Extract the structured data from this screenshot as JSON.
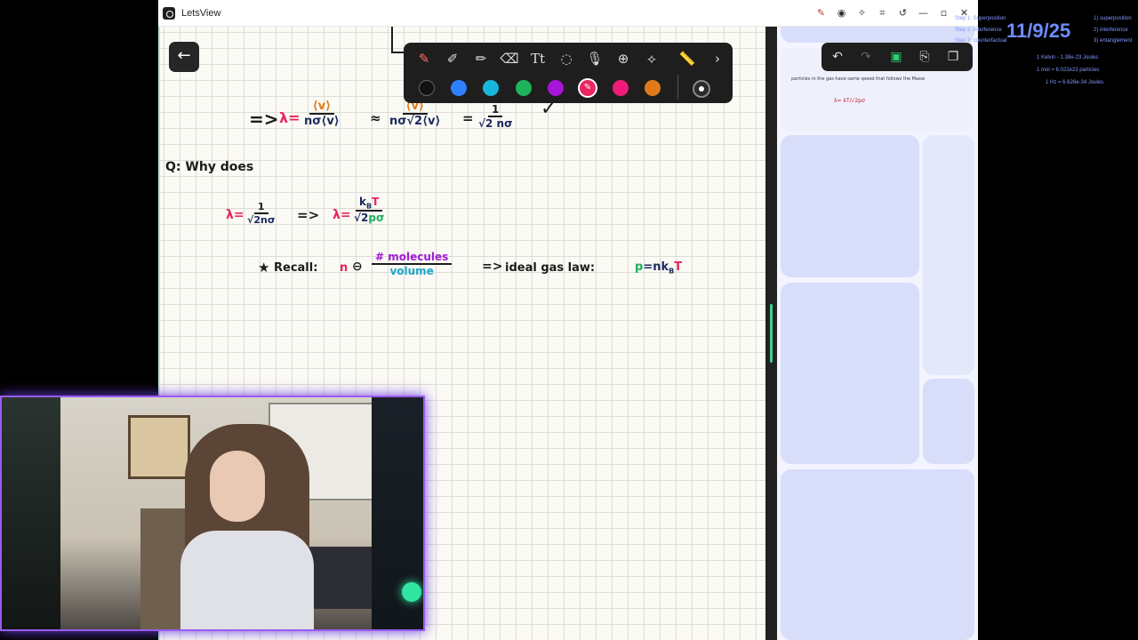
{
  "window": {
    "title": "LetsView",
    "titlebar_icons": [
      "annotate-icon",
      "record-icon",
      "pin-icon",
      "crop-icon",
      "history-icon",
      "minimize-icon",
      "maximize-icon",
      "close-icon"
    ]
  },
  "toolbar": {
    "tools": [
      "pen-icon",
      "marker-icon",
      "pencil-icon",
      "eraser-icon",
      "text-icon",
      "lasso-icon",
      "mic-icon",
      "add-icon",
      "shape-icon",
      "ruler-icon",
      "next-icon"
    ],
    "colors": [
      "#111111",
      "#2f80ff",
      "#18b6d8",
      "#21b35a",
      "#a715d6",
      "#e8255e",
      "#f01a7a",
      "#e0791a"
    ],
    "selected_color": "#e8255e"
  },
  "right_toolbar": {
    "tools": [
      "undo-icon",
      "redo-icon",
      "screen-icon",
      "export-icon",
      "pages-icon"
    ]
  },
  "notes": {
    "line1_arrow": "=>",
    "line1_lambda": "λ=",
    "line1_f1_num": "⟨v⟩",
    "line1_f1_den": "nσ⟨v⟩",
    "line1_approx": "≈",
    "line1_f2_num": "⟨v⟩",
    "line1_f2_den": "nσ√2⟨v⟩",
    "line1_eq": "=",
    "line1_f3_num": "1",
    "line1_f3_den": "√2 nσ",
    "line1_check": "✓",
    "question": "Q: Why does",
    "line2_lambda": "λ=",
    "line2_f1_num": "1",
    "line2_f1_den": "√2nσ",
    "line2_arrow": "=>",
    "line2_lambda2": "λ=",
    "line2_f2_num": "k",
    "line2_f2_num_sub": "B",
    "line2_f2_num_T": "T",
    "line2_f2_den": "√2",
    "line2_f2_den_p": "pσ",
    "recall_star": "★",
    "recall_label": "Recall:",
    "recall_n": "n",
    "recall_theta": "⊖",
    "recall_num": "# molecules",
    "recall_den": "volume",
    "recall_arrow": "=>",
    "recall_law": "ideal gas law:",
    "recall_p": "p",
    "recall_eq": "=n",
    "recall_k": "k",
    "recall_sub": "B",
    "recall_T": "T"
  },
  "thumbnail": {
    "line1": "particles in the gas have same speed that follows the Maxw",
    "formula": "λ= kT/√2pσ"
  },
  "overlay": {
    "date": "11/9/25",
    "left_items": [
      "Step 1: Superposition",
      "Step 2: Interference",
      "Step 3: counterfactual"
    ],
    "right_items": [
      "1) superposition",
      "2) interference",
      "3) entanglement"
    ],
    "constants": [
      "1 Kelvin - 1.38e-23 Joules",
      "1 mol = 6.022e23 particles",
      "1 Hz = 6.626e-34 Joules"
    ]
  }
}
